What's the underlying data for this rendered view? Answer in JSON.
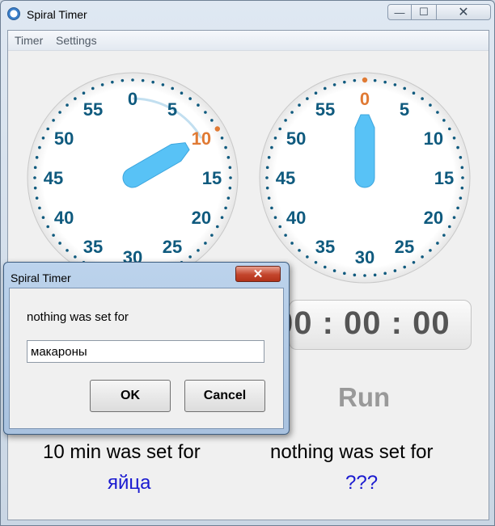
{
  "window": {
    "title": "Spiral Timer",
    "app_icon": "spiral-timer-icon",
    "controls": {
      "minimize": "—",
      "maximize": "☐",
      "close": "✕"
    }
  },
  "menu": [
    "Timer",
    "Settings"
  ],
  "dial_numbers": [
    "0",
    "5",
    "10",
    "15",
    "20",
    "25",
    "30",
    "35",
    "40",
    "45",
    "50",
    "55"
  ],
  "left_timer": {
    "set_minutes": 10,
    "highlight": "10",
    "hand_minute": 10,
    "status": "10 min was set for",
    "name": "яйца"
  },
  "right_timer": {
    "set_minutes": 0,
    "highlight": "0",
    "hand_minute": 0,
    "time": "00 : 00 : 00",
    "run_label": "Run",
    "status": "nothing was set for",
    "name": "???"
  },
  "colors": {
    "dial_number": "#0f5a7e",
    "highlight": "#e07a34",
    "hand": "#58c2f6",
    "name_text": "#1a1ad0"
  },
  "dialog": {
    "title": "Spiral Timer",
    "close": "✕",
    "prompt": "nothing was set for",
    "input_value": "макароны",
    "ok_label": "OK",
    "cancel_label": "Cancel"
  }
}
